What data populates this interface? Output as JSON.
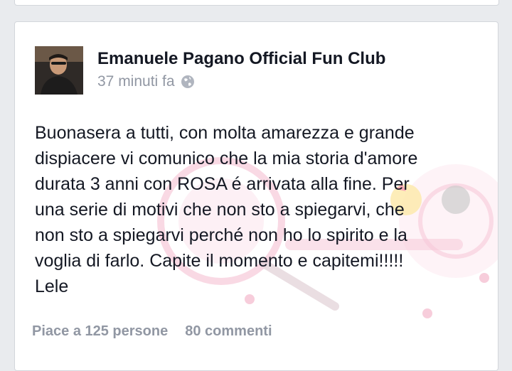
{
  "post": {
    "author": "Emanuele Pagano Official Fun Club",
    "timestamp": "37 minuti fa",
    "privacy_icon": "globe-icon",
    "text_lines": [
      "Buonasera a tutti, con molta amarezza e grande",
      "dispiacere vi comunico che la mia storia d'amore",
      "durata 3 anni con ROSA é arrivata alla fine. Per",
      "una serie di motivi che non sto a spiegarvi, che",
      "non sto a spiegarvi perché non ho lo spirito e la",
      "voglia di farlo. Capite il momento e capitemi!!!!!",
      "Lele"
    ],
    "likes": "Piace a 125 persone",
    "comments": "80 commenti"
  },
  "colors": {
    "background": "#e9ebee",
    "card": "#ffffff",
    "text": "#141823",
    "muted": "#9197a3",
    "watermark_pink": "#f3b8cc"
  }
}
